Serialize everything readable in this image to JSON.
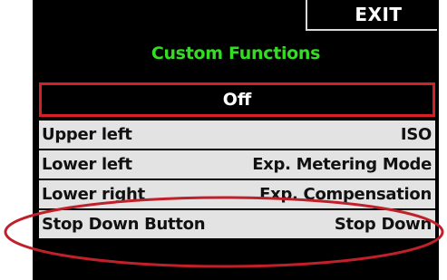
{
  "header": {
    "exit_label": "EXIT",
    "title": "Custom Functions"
  },
  "mode": {
    "value": "Off"
  },
  "settings": [
    {
      "label": "Upper left",
      "value": "ISO"
    },
    {
      "label": "Lower left",
      "value": "Exp. Metering Mode"
    },
    {
      "label": "Lower right",
      "value": "Exp. Compensation"
    },
    {
      "label": "Stop Down Button",
      "value": "Stop Down"
    }
  ],
  "colors": {
    "background": "#000000",
    "title": "#33dd22",
    "mode_border": "#d4202a",
    "row_background": "#e3e3e3",
    "highlight_ellipse": "#c0202a"
  }
}
